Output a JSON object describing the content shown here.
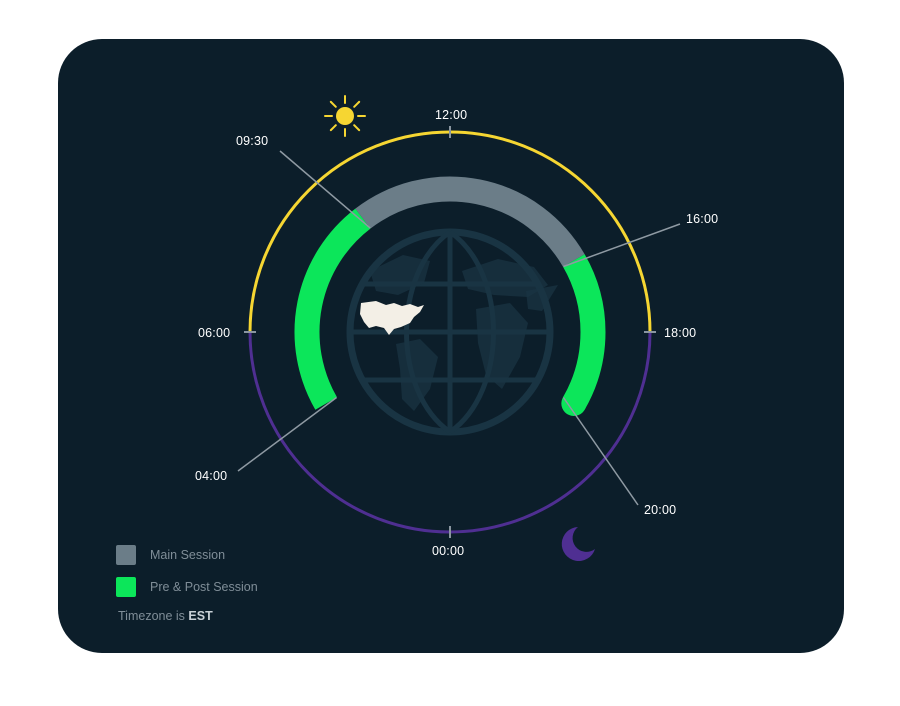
{
  "colors": {
    "background": "#0c1e2a",
    "day_ring": "#f6d632",
    "night_ring": "#4f2f92",
    "main_session": "#6b7d88",
    "pre_post_session": "#0ce65a",
    "sun": "#f6d632",
    "moon": "#4f2f92",
    "globe": "#193443",
    "usa": "#f3efe6"
  },
  "icons": {
    "day": "sun-icon",
    "night": "moon-icon",
    "center": "globe-icon",
    "highlight": "usa-map-icon"
  },
  "clock": {
    "hours_labels": [
      "12:00",
      "18:00",
      "00:00",
      "06:00"
    ],
    "session_times": {
      "pre_start": "04:00",
      "main_start": "09:30",
      "main_end": "16:00",
      "post_end": "20:00"
    }
  },
  "legend": {
    "main_label": "Main Session",
    "pre_post_label": "Pre & Post Session"
  },
  "timezone": {
    "prefix": "Timezone is ",
    "value": "EST"
  }
}
